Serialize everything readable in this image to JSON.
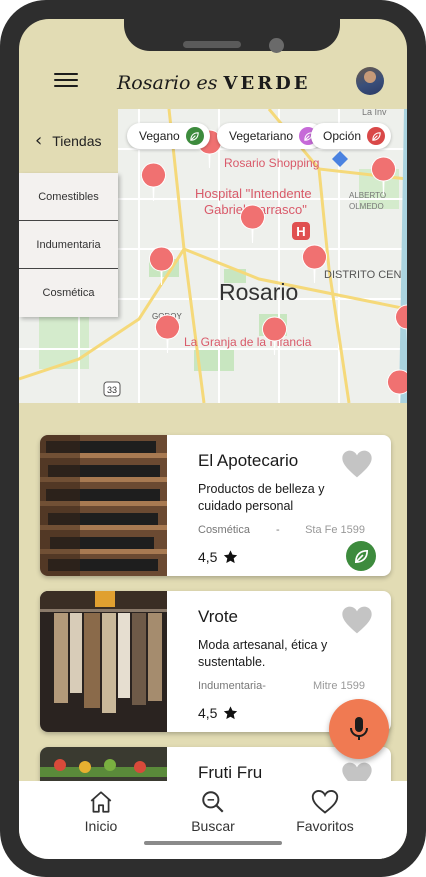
{
  "app": {
    "brand_script": "Rosario es",
    "brand_bold": "VERDE"
  },
  "map": {
    "city_label": "Rosario",
    "places": [
      "Rosario Shopping",
      "Hospital \"Intendente",
      "Gabriel Carrasco\"",
      "La Granja de la Infancia",
      "ALBERTO",
      "OLMEDO",
      "DISTRITO CEN",
      "GODOY",
      "La Inv"
    ],
    "route_number": "33"
  },
  "filters": [
    {
      "label": "Vegano",
      "color": "#3d8b3d",
      "icon": "leaf-icon"
    },
    {
      "label": "Vegetariano",
      "color": "#c66ad8",
      "icon": "leaf-icon"
    },
    {
      "label": "Opción",
      "color": "#d94848",
      "icon": "leaf-icon"
    }
  ],
  "sidebar": {
    "header": "Tiendas",
    "items": [
      "Comestibles",
      "Indumentaria",
      "Cosmética"
    ]
  },
  "stores": [
    {
      "name": "El Apotecario",
      "description": "Productos de belleza y cuidado personal",
      "category": "Cosmética",
      "separator": "-",
      "address": "Sta Fe 1599",
      "rating": "4,5"
    },
    {
      "name": "Vrote",
      "description": "Moda artesanal, ética y sustentable.",
      "category": "Indumentaria-",
      "address": "Mitre 1599",
      "rating": "4,5"
    },
    {
      "name": "Fruti Fru"
    }
  ],
  "nav": {
    "items": [
      {
        "label": "Inicio",
        "icon": "home-icon"
      },
      {
        "label": "Buscar",
        "icon": "search-icon"
      },
      {
        "label": "Favoritos",
        "icon": "heart-icon"
      }
    ]
  },
  "colors": {
    "background": "#e2dcb4",
    "accent": "#f07a52",
    "vegan_green": "#3d8b3d"
  }
}
